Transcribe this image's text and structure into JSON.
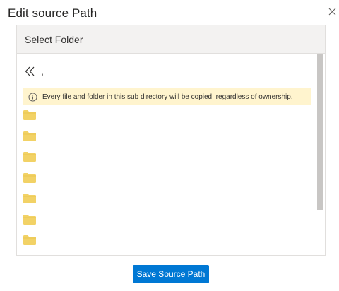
{
  "dialog": {
    "title": "Edit source Path",
    "close_icon": "close-icon"
  },
  "folder_picker": {
    "header": "Select Folder",
    "back_icon": "double-chevron-left-icon",
    "current_path": ",",
    "notice": {
      "icon": "info-icon",
      "text": "Every file and folder in this sub directory will be copied, regardless of ownership."
    },
    "folders": [
      {
        "icon": "folder-icon",
        "name": ""
      },
      {
        "icon": "folder-icon",
        "name": ""
      },
      {
        "icon": "folder-icon",
        "name": ""
      },
      {
        "icon": "folder-icon",
        "name": ""
      },
      {
        "icon": "folder-icon",
        "name": ""
      },
      {
        "icon": "folder-icon",
        "name": ""
      },
      {
        "icon": "folder-icon",
        "name": ""
      }
    ]
  },
  "actions": {
    "save_label": "Save Source Path"
  },
  "colors": {
    "accent": "#0078d4",
    "notice_bg": "#fff4ce",
    "folder": "#f2d266",
    "header_bg": "#f3f2f1"
  }
}
